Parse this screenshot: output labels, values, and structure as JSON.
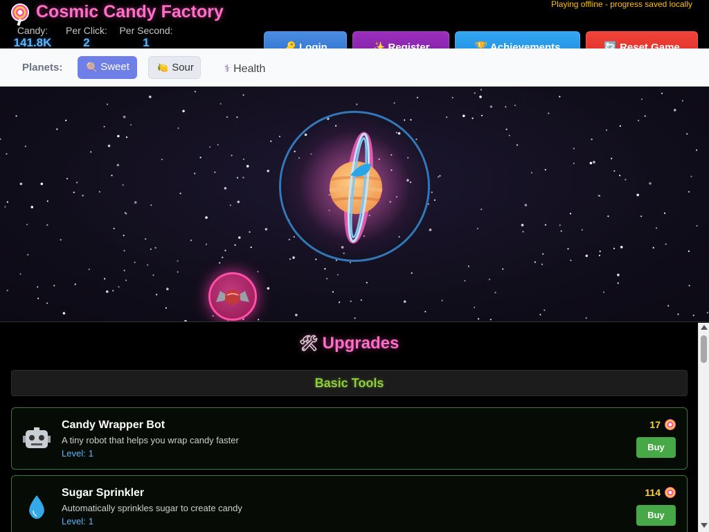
{
  "header": {
    "title": "Cosmic Candy Factory",
    "status": "Playing offline - progress saved locally",
    "stats": {
      "candy_label": "Candy:",
      "candy_value": "141.8K",
      "per_click_label": "Per Click:",
      "per_click_value": "2",
      "per_second_label": "Per Second:",
      "per_second_value": "1"
    },
    "buttons": {
      "login": "🔑 Login",
      "register": "✨ Register",
      "achievements": "🏆 Achievements",
      "reset": "🔄 Reset Game"
    }
  },
  "planets": {
    "label": "Planets:",
    "items": [
      {
        "label": "Sweet",
        "icon": "lollipop-icon",
        "active": true
      },
      {
        "label": "Sour",
        "icon": "lemon-icon",
        "active": false
      },
      {
        "label": "Health",
        "icon": "caduceus-icon",
        "active": false
      }
    ]
  },
  "upgrades": {
    "title": "Upgrades",
    "category": "Basic Tools",
    "level_label": "Level:",
    "buy_label": "Buy",
    "items": [
      {
        "name": "Candy Wrapper Bot",
        "description": "A tiny robot that helps you wrap candy faster",
        "level": "1",
        "cost": "17",
        "icon": "robot-icon"
      },
      {
        "name": "Sugar Sprinkler",
        "description": "Automatically sprinkles sugar to create candy",
        "level": "1",
        "cost": "114",
        "icon": "droplet-icon"
      }
    ]
  },
  "colors": {
    "title_pink": "#ff6ec7",
    "stat_blue": "#58b7ff",
    "cost_yellow": "#ffd33d",
    "category_green": "#8fce3a",
    "buy_green": "#46a846"
  }
}
